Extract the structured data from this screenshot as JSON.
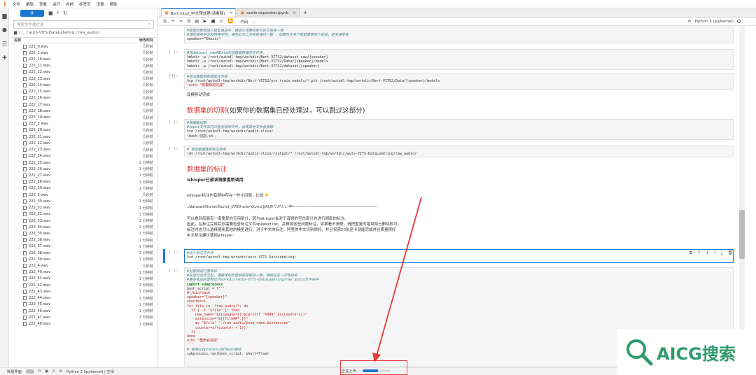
{
  "menu": [
    "文件",
    "编辑",
    "查看",
    "运行",
    "内核",
    "标签页",
    "设置",
    "帮助"
  ],
  "filebrowser": {
    "search_placeholder": "搜索文件或过滤",
    "crumb_root_icon": "folder-icon",
    "crumb": "/ ... / auto-VITS-DataLabeling / raw_audio /",
    "col_name": "名称",
    "col_time": "修改时间",
    "files": [
      {
        "name": "222_0.wav",
        "time": "几秒前"
      },
      {
        "name": "222_1.wav",
        "time": "几秒前"
      },
      {
        "name": "222_10.wav",
        "time": "几秒前"
      },
      {
        "name": "222_11.wav",
        "time": "几秒前"
      },
      {
        "name": "222_12.wav",
        "time": "几秒前"
      },
      {
        "name": "222_13.wav",
        "time": "几秒前"
      },
      {
        "name": "222_14.wav",
        "time": "几秒前"
      },
      {
        "name": "222_15.wav",
        "time": "几秒前"
      },
      {
        "name": "222_16.wav",
        "time": "几秒前"
      },
      {
        "name": "222_17.wav",
        "time": "几秒前"
      },
      {
        "name": "222_18.wav",
        "time": "几秒前"
      },
      {
        "name": "222_19.wav",
        "time": "几秒前"
      },
      {
        "name": "222_2.wav",
        "time": "几秒前"
      },
      {
        "name": "222_20.wav",
        "time": "几秒前"
      },
      {
        "name": "222_21.wav",
        "time": "几秒前"
      },
      {
        "name": "222_22.wav",
        "time": "几秒前"
      },
      {
        "name": "222_23.wav",
        "time": "几秒前"
      },
      {
        "name": "222_24.wav",
        "time": "几秒前"
      },
      {
        "name": "222_25.wav",
        "time": "1 分钟前"
      },
      {
        "name": "222_26.wav",
        "time": "1 分钟前"
      },
      {
        "name": "222_27.wav",
        "time": "1 分钟前"
      },
      {
        "name": "222_28.wav",
        "time": "1 分钟前"
      },
      {
        "name": "222_29.wav",
        "time": "1 分钟前"
      },
      {
        "name": "222_3.wav",
        "time": "几秒前"
      },
      {
        "name": "222_30.wav",
        "time": "1 分钟前"
      },
      {
        "name": "222_31.wav",
        "time": "1 分钟前"
      },
      {
        "name": "222_32.wav",
        "time": "1 分钟前"
      },
      {
        "name": "222_33.wav",
        "time": "1 分钟前"
      },
      {
        "name": "222_34.wav",
        "time": "1 分钟前"
      },
      {
        "name": "222_35.wav",
        "time": "1 分钟前"
      },
      {
        "name": "222_36.wav",
        "time": "1 分钟前"
      },
      {
        "name": "222_37.wav",
        "time": "1 分钟前"
      },
      {
        "name": "222_38.wav",
        "time": "1 分钟前"
      },
      {
        "name": "222_39.wav",
        "time": "1 分钟前"
      },
      {
        "name": "222_4.wav",
        "time": "几秒前"
      },
      {
        "name": "222_40.wav",
        "time": "1 分钟前"
      },
      {
        "name": "222_41.wav",
        "time": "1 分钟前"
      },
      {
        "name": "222_42.wav",
        "time": "1 分钟前"
      },
      {
        "name": "222_43.wav",
        "time": "1 分钟前"
      },
      {
        "name": "222_44.wav",
        "time": "1 分钟前"
      },
      {
        "name": "222_45.wav",
        "time": "1 分钟前"
      },
      {
        "name": "222_46.wav",
        "time": "1 分钟前"
      },
      {
        "name": "222_47.wav",
        "time": "1 分钟前"
      },
      {
        "name": "222_48.wav",
        "time": "1 分钟前"
      }
    ]
  },
  "tabs": [
    {
      "label": "Bert-vits2_中文预处理(请看我)"
    },
    {
      "label": "audio separator.ipynb"
    }
  ],
  "toolbar": {
    "cell_type": "代码",
    "kernel": "Python 3 (ipykernel)"
  },
  "cells": {
    "c0_line1": "#模型名称即进入模型语言中，请填写完整名称与官方名称一致",
    "c0_line2": "#请勿使用中文及特殊字符，请务必与上方名称保持一致 ，如果包含多个模型请使用下划线，更多请参考 ",
    "c0_line3": "speaker=\"Khazix\"",
    "c1_prompt": "[ ]:",
    "c1_l1": "#在dataset_raw和Data内创建音频保存文件夹",
    "c1_l2": "%mkdir -p /root/autodl-tmp/workdir/Bert-VITS2/dataset_raw/{speaker}",
    "c1_l3": "%mkdir -p /root/autodl-tmp/workdir/Bert-VITS2/Data/{speaker}/models",
    "c1_l4": "%mkdir -p /root/autodl-tmp/workdir/Bert-VITS2/dataset/{speaker}",
    "c2_prompt": "[4]:",
    "c2_l1": "#移动底模到新模型文件夹",
    "c2_l2": "%cp /root/autodl-tmp/workdir/Bert-VITS2/pre_train_models/*.pth /root/autodl-tmp/workdir/Bert-VITS2/Data/{speaker}/models",
    "c2_l3": "!echo \"底模移动完成\"",
    "c2_out": "底模移动完成",
    "h_slice_red": "数据集的切割",
    "h_slice_rest": "(如果你的数据集已经处理过，可以跳过这部分)",
    "c3_prompt": "[ ]:",
    "c3_l1": "#数据集切割",
    "c3_l2": "#input文件夹内只能有音频文件，出现其他文件会报错",
    "c3_l3": "%cd /root/autodl-tmp/workdir/audio-slicer",
    "c3_l4": "!bash 切割.sh",
    "c4_prompt": "[ ]:",
    "c4_l1": "# 移动数据集到标注目录",
    "c4_l2": "!mv /root/autodl-tmp/workdir/audio-slicer/output/* /root/autodl-tmp/workdir/auto-VITS-DataLabeling/raw_audio/",
    "h_label": "数据集的标注",
    "h_whisper": "whisper已被该镜像重新调用",
    "md1": "whisper标注的音频中存在一些小问题，比如 ",
    "md2": "./dataset/Gunst/Gunst_0780.wav|Gunst|JA|ありがとい中——————————————————————",
    "md3": "可以看到后面有一串重复的无用部分，因为whisper会对于音频的空白部分也进行胡乱的标注。",
    "md4": "因此，在标注完成后你需要检查标注文件speaker.list，并删掉这些问题标注，如果看不清楚，请把重复的错误部分删除即可。",
    "md5": "标注时也可以选择使用其他的模型进行，对于中文的标注，阿里的中文识别很好，并且仅需20张显卡就能完成并且质量很好",
    "md6": "中文标注建议使用whisper",
    "c5_prompt": "[ ]:",
    "c5_l1": "#进入标注文件夹",
    "c5_l2": "%cd /root/autodl-tmp/workdir/auto-VITS-DataLabeling/",
    "c6_prompt": "[ ]:",
    "c6_l1": "#对音频进行重命名",
    "c6_l2": "#在运行这步之前，请确保你的音频名称保持一致，请保证这一次性命名",
    "c6_l3": "#重命名后的音频位于workdir/auto-VITS-DataLabeling/raw_audio文件夹中",
    "c6_l4": "import subprocess",
    "c6_l5": "bash_script = f'''",
    "c6_l6": "#!/bin/bash",
    "c6_l7": "speaker=\"{speaker}\"",
    "c6_l8": "counter=1",
    "c6_l9": "for file in ./raw_audio/*; do",
    "c6_l10": "  if [ -f \"$file\" ]; then",
    "c6_l11": "    new_name=\"${{speaker}}_$(printf \"%04d\" ${{counter}})\"",
    "c6_l12": "    extension=\"${{file##*.}}\"",
    "c6_l13": "    mv \"$file\" \"./raw_audio/$new_name.$extension\"",
    "c6_l14": "    counter=$((counter + 1))",
    "c6_l15": "  fi",
    "c6_l16": "done",
    "c6_l17": "echo \"重命名完成\"",
    "c6_l18": "'''",
    "c6_l19": "# 使用subprocess运行bash脚本",
    "c6_l20": "subprocess.run(bash_script, shell=True)"
  },
  "status": {
    "mode": "简易界面",
    "n1": "0",
    "n2": "2",
    "kernel": "Python 3 (ipykernel) | 空闲",
    "upload_label": "正在上传...",
    "upload_progress": 0.55
  },
  "watermark": "AICG搜索"
}
